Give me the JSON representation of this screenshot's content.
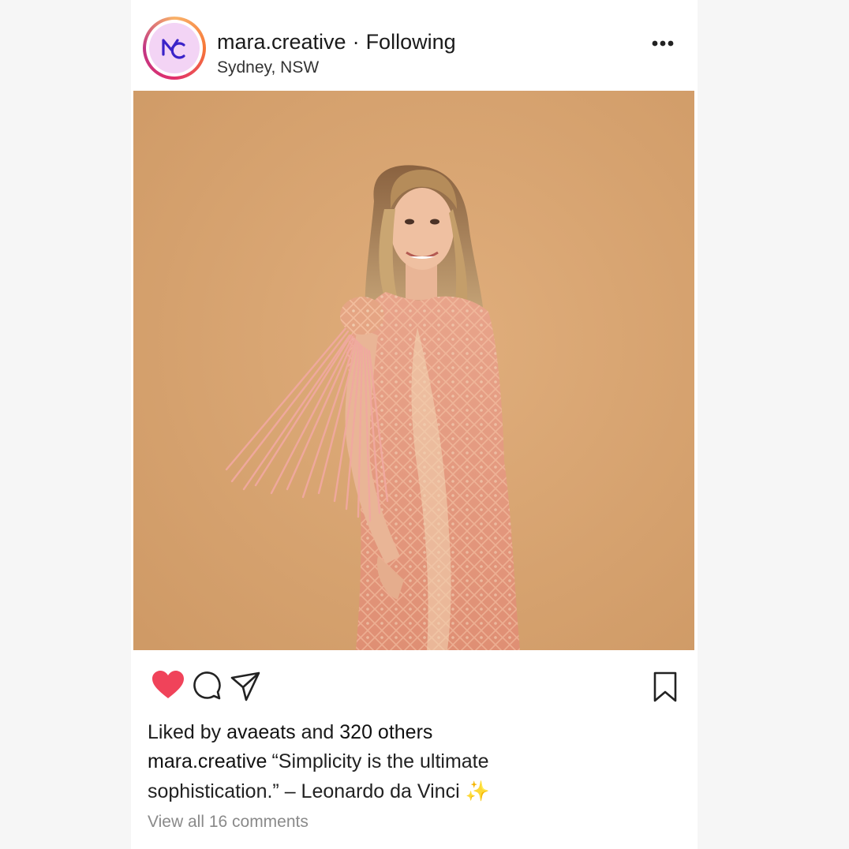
{
  "post": {
    "username": "mara.creative",
    "separator": "·",
    "follow_status": "Following",
    "location": "Sydney, NSW",
    "avatar_initials": "MC",
    "photo_alt": "",
    "liked_by_prefix": "Liked by",
    "liked_by_user": "avaeats",
    "liked_by_and": "and",
    "liked_by_others": "320 others",
    "caption_user": "mara.creative",
    "caption_text": "“Simplicity is the ultimate sophistication.” – Leonardo da Vinci ✨",
    "view_comments": "View all 16 comments"
  },
  "icons": {
    "more": "more-dots-icon",
    "like": "heart-icon",
    "comment": "comment-icon",
    "share": "paper-plane-icon",
    "save": "bookmark-icon"
  },
  "colors": {
    "like_active": "#f0435a",
    "avatar_bg": "#f3d4f5",
    "avatar_mark": "#3b23c9",
    "photo_bg": "#d9a571",
    "dress": "#e79c82"
  }
}
